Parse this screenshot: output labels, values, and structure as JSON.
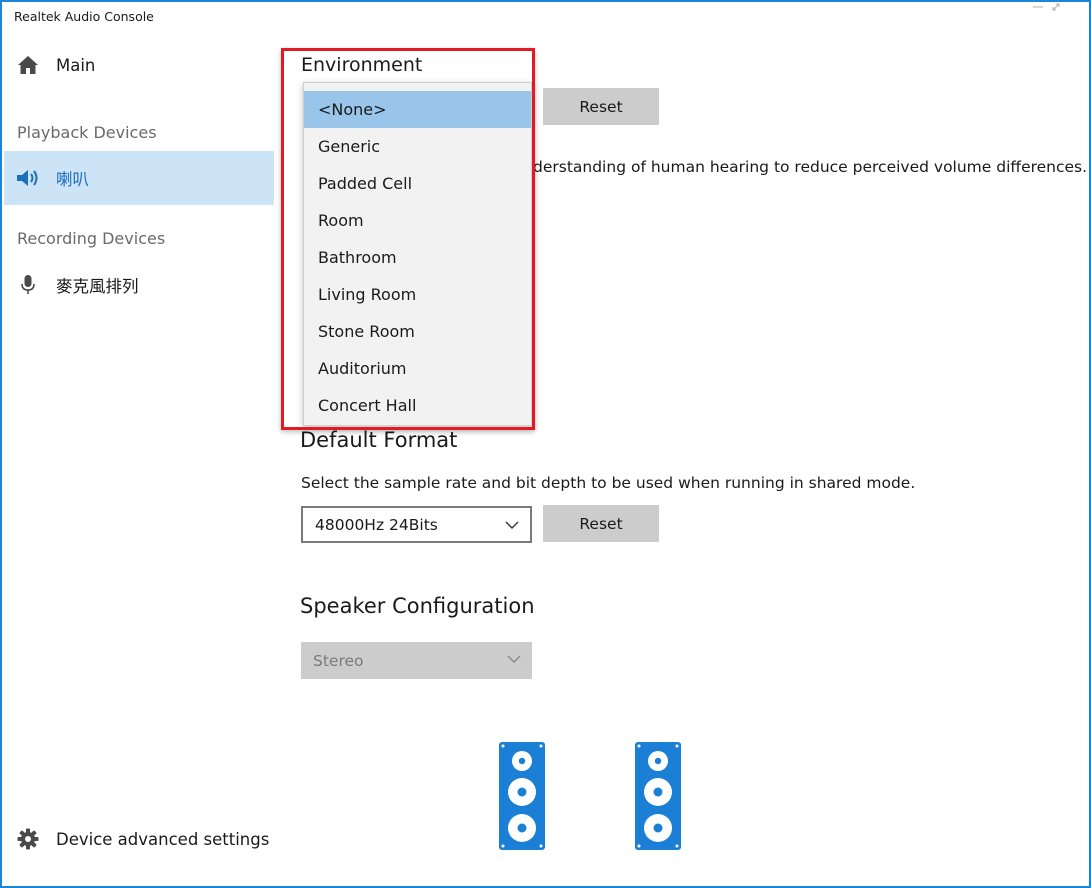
{
  "window": {
    "title": "Realtek Audio Console"
  },
  "sidebar": {
    "main_label": "Main",
    "playback_section": "Playback Devices",
    "playback_device": "喇叭",
    "recording_section": "Recording Devices",
    "recording_device": "麥克風排列",
    "advanced_settings": "Device advanced settings"
  },
  "environment": {
    "title": "Environment",
    "reset_label": "Reset",
    "description_partial": "derstanding of human hearing to reduce perceived volume differences.",
    "options": [
      "<None>",
      "Generic",
      "Padded Cell",
      "Room",
      "Bathroom",
      "Living Room",
      "Stone Room",
      "Auditorium",
      "Concert Hall"
    ],
    "selected": "<None>"
  },
  "default_format": {
    "title": "Default Format",
    "description": "Select the sample rate and bit depth to be used when running in shared mode.",
    "value": "48000Hz 24Bits",
    "reset_label": "Reset"
  },
  "speaker_configuration": {
    "title": "Speaker Configuration",
    "value": "Stereo"
  },
  "colors": {
    "accent": "#1b86d8",
    "selection": "#cde3f6",
    "dropdown_selected": "#99c5ea",
    "highlight": "#e01b24",
    "speaker": "#1b7fd6"
  },
  "icons": {
    "main": "home-icon",
    "playback": "speaker-volume-icon",
    "recording": "microphone-icon",
    "advanced": "gear-icon"
  }
}
